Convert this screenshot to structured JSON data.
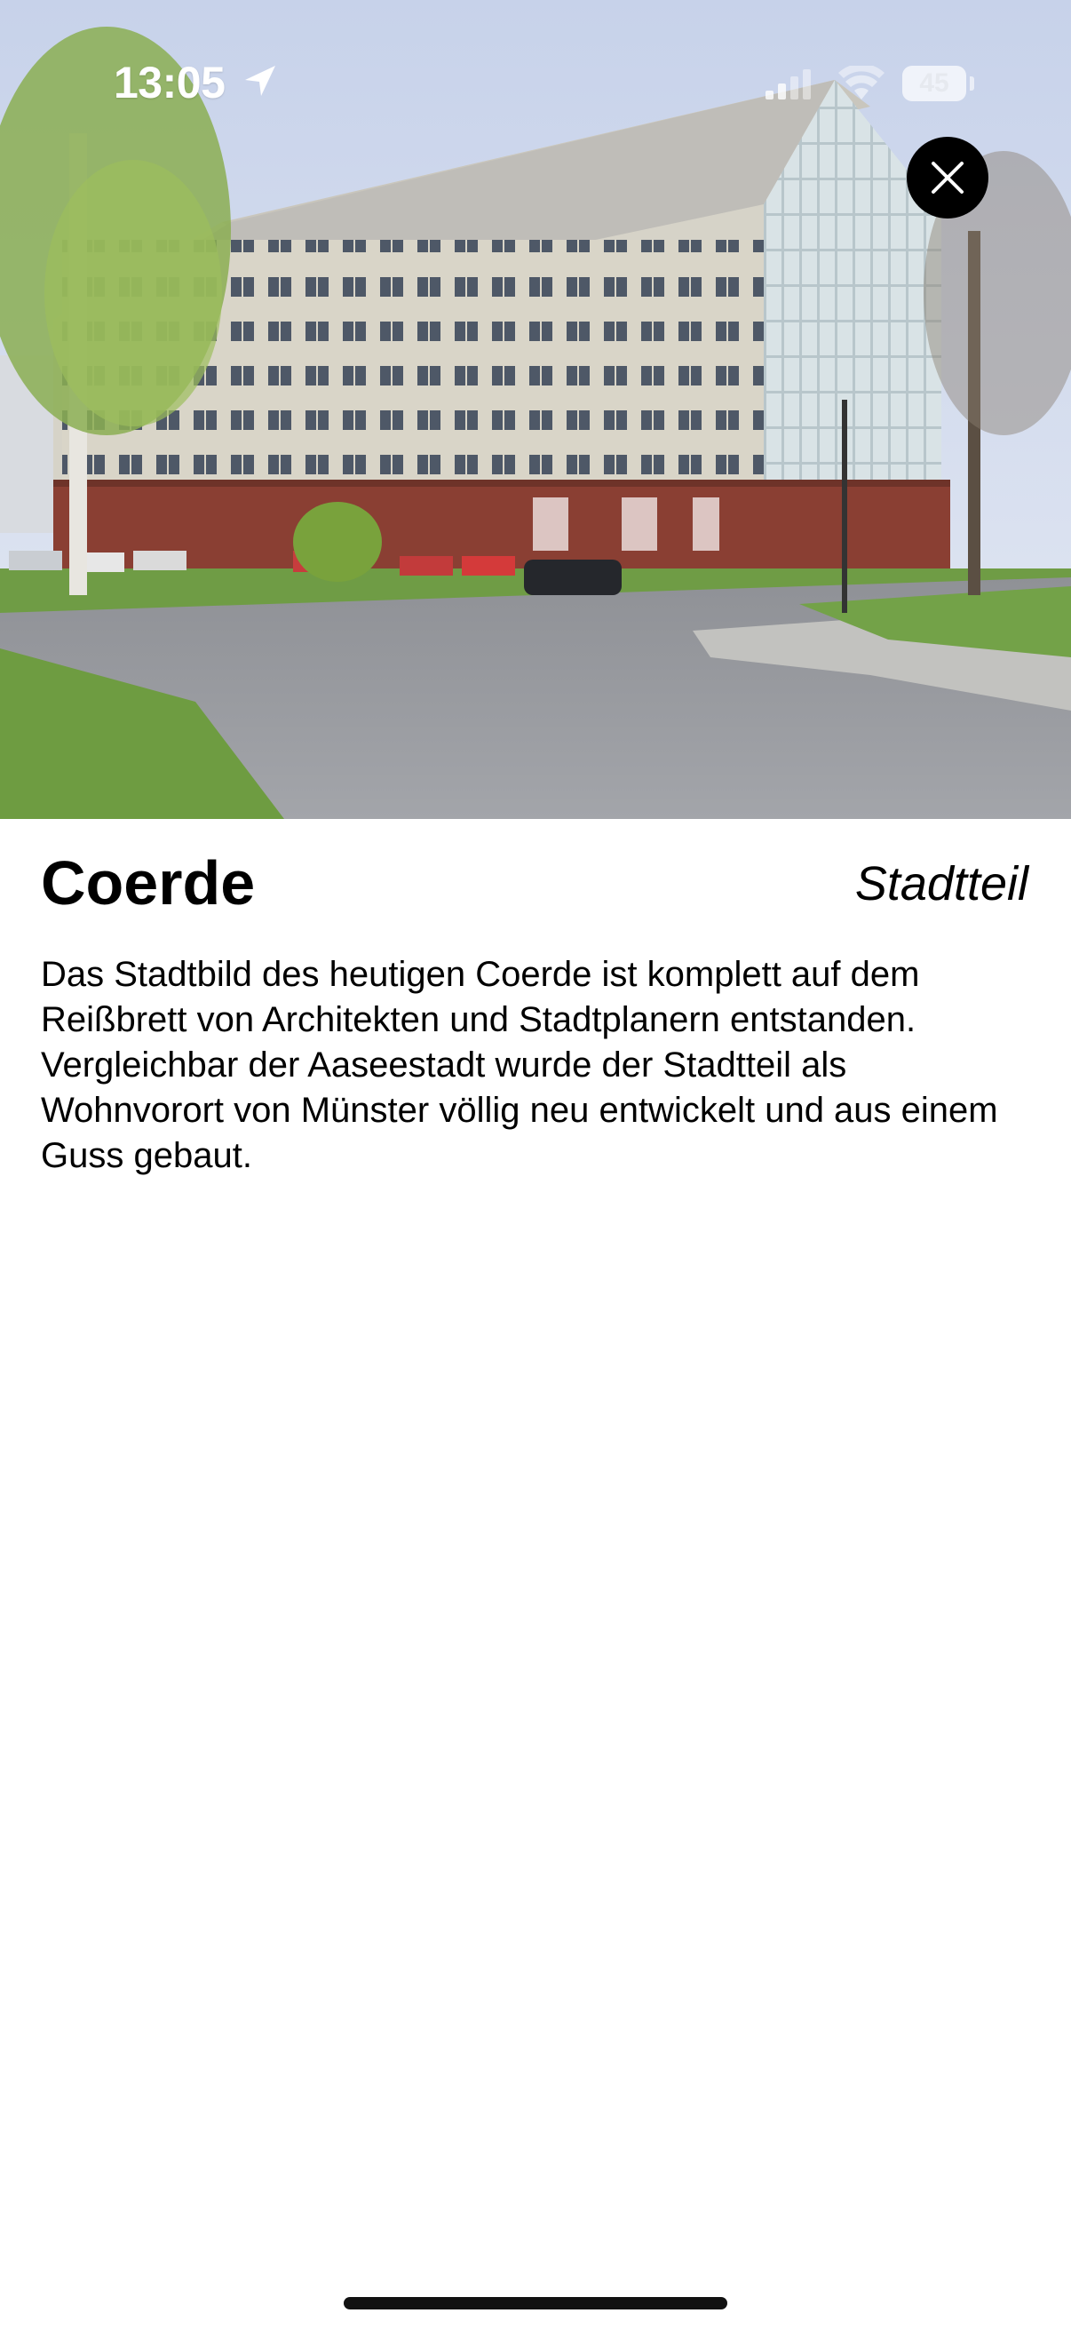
{
  "status_bar": {
    "time": "13:05",
    "battery_level": "45",
    "icons": [
      "location-arrow-icon",
      "cellular-signal-icon",
      "wifi-icon",
      "battery-icon"
    ]
  },
  "hero": {
    "image": "photo-of-building",
    "close_icon": "close-icon"
  },
  "place": {
    "name": "Coerde",
    "category": "Stadtteil",
    "description": "Das Stadtbild des heutigen Coerde ist komplett auf dem Reißbrett von Architekten und Stadtplanern entstanden. Vergleichbar der Aaseestadt wurde der Stadtteil als Wohnvorort von Münster völlig neu entwickelt und aus einem Guss gebaut."
  },
  "colors": {
    "background": "#ffffff",
    "text": "#000000",
    "close_button": "#000000"
  }
}
